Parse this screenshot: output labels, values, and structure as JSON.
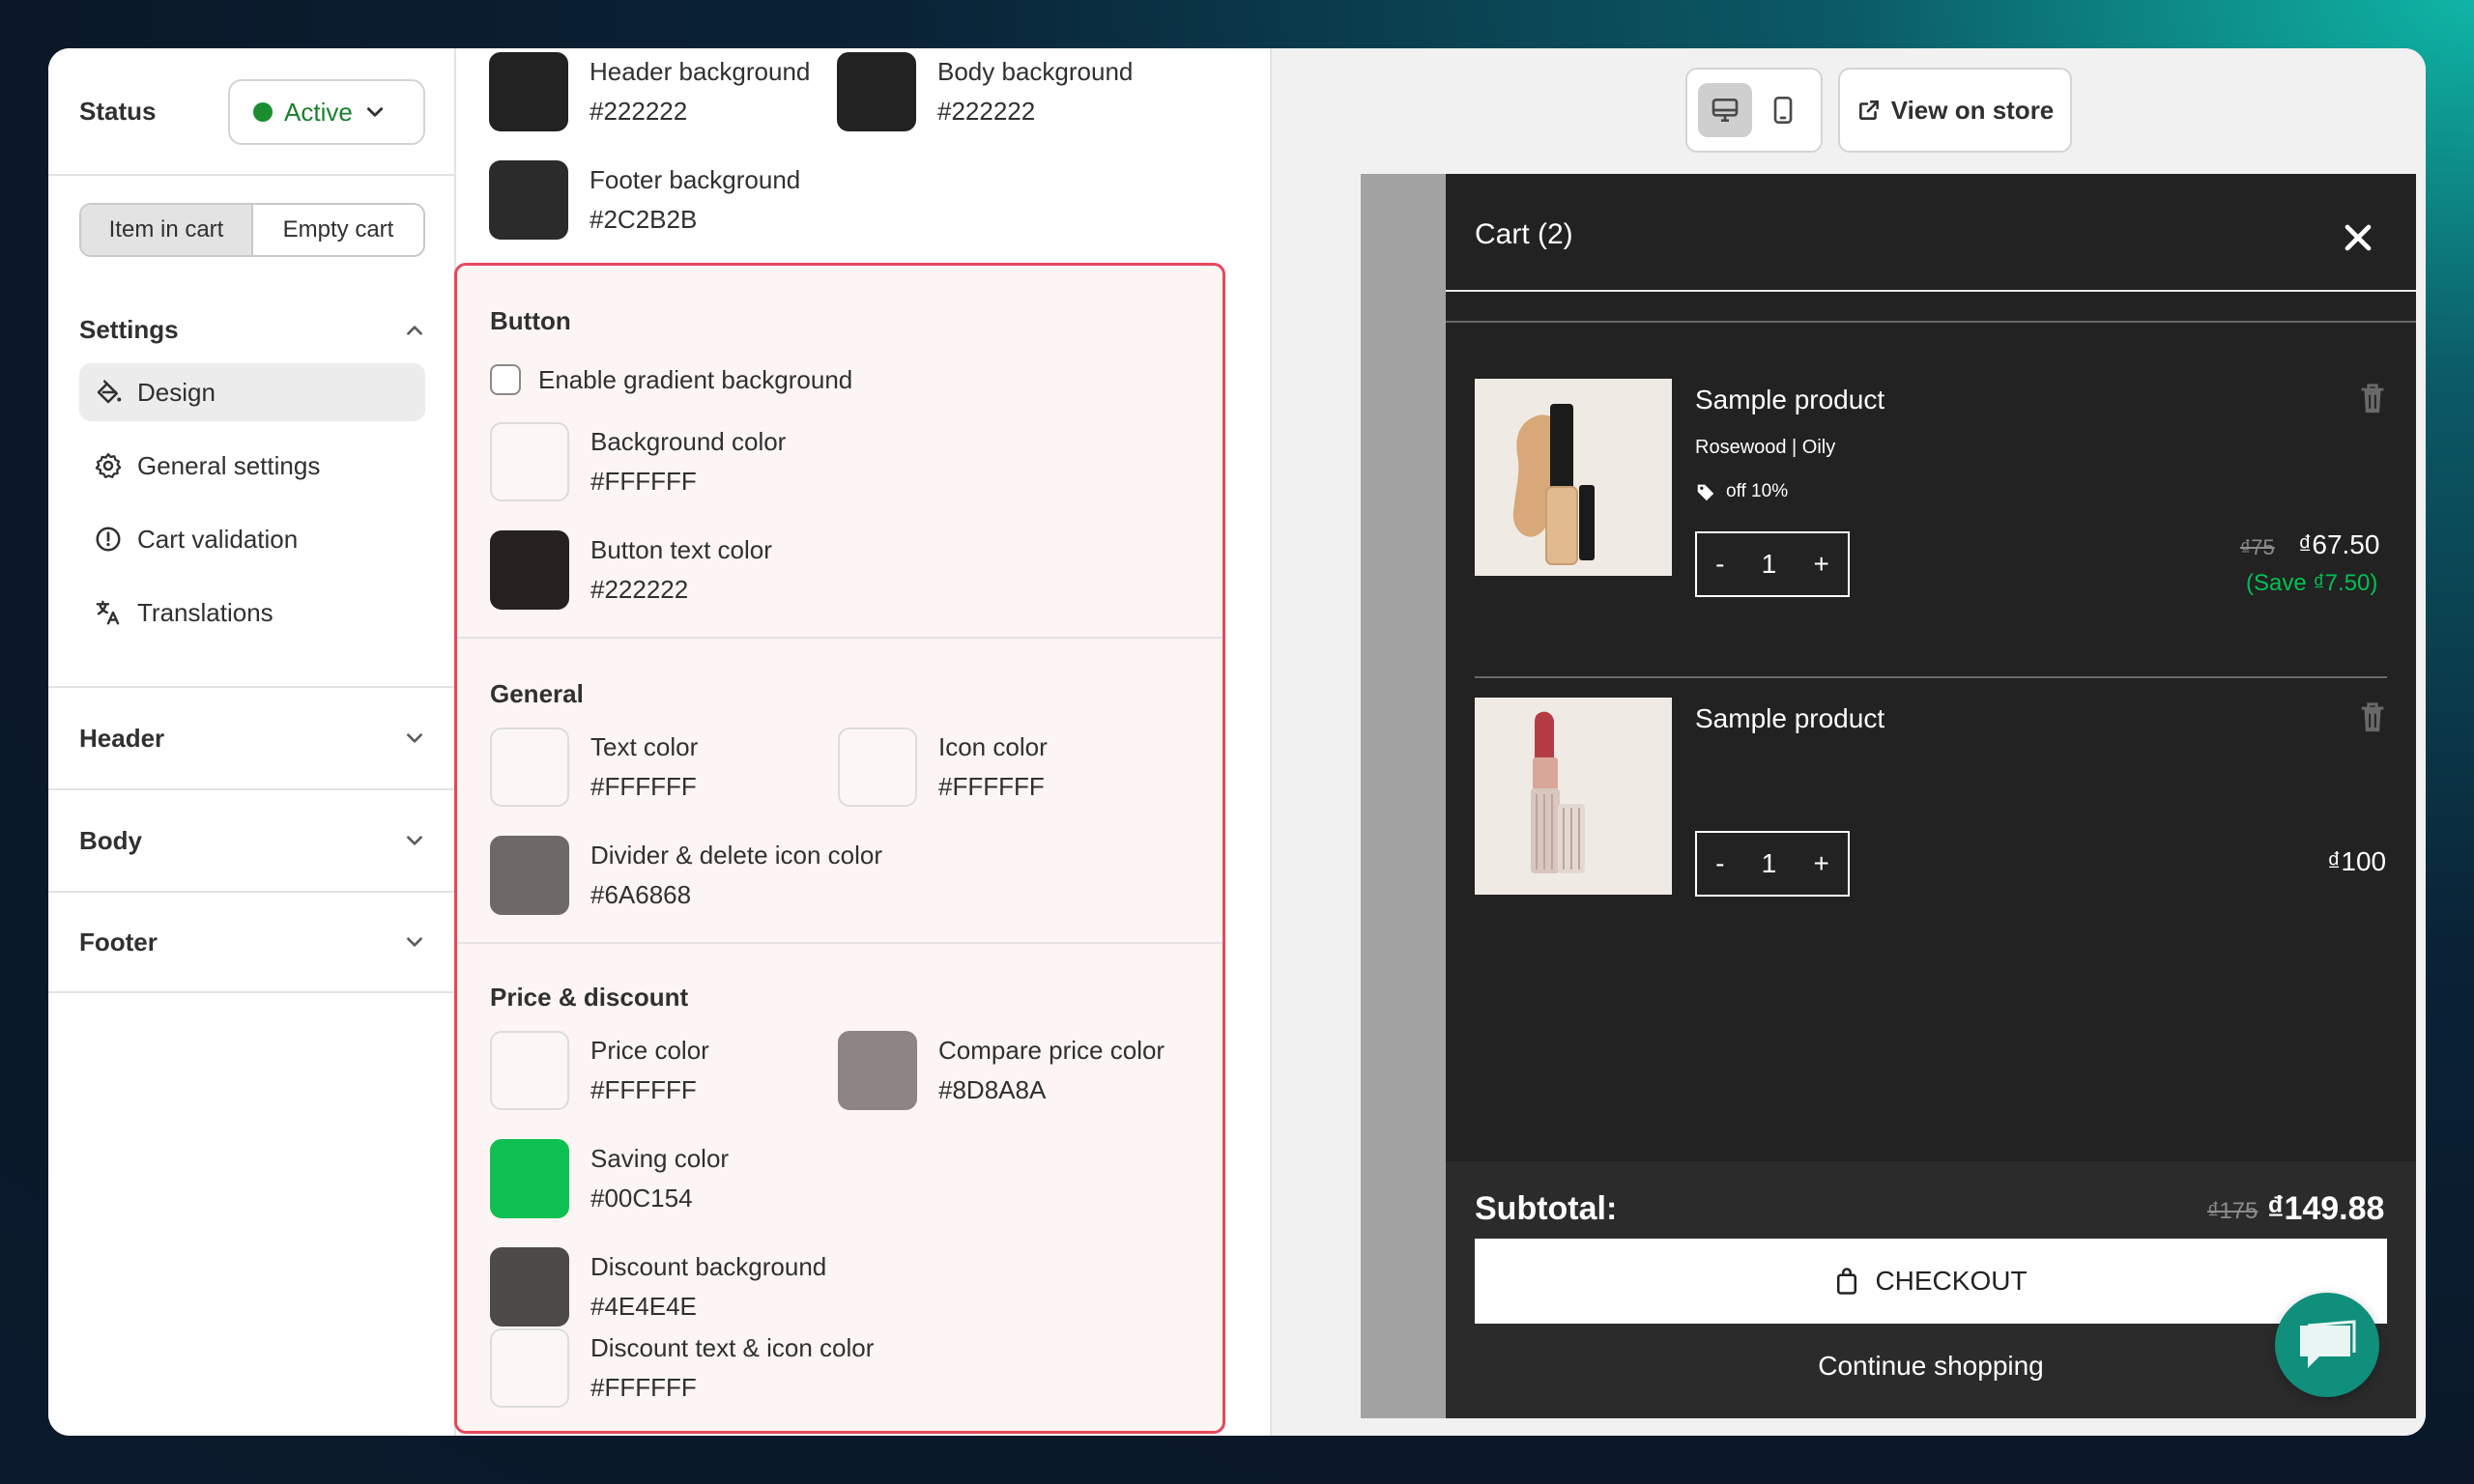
{
  "sidebar": {
    "status_label": "Status",
    "status_value": "Active",
    "status_color": "#1a8e2f",
    "segments": [
      "Item in cart",
      "Empty cart"
    ],
    "settings_title": "Settings",
    "nav": [
      {
        "label": "Design",
        "icon": "paint-bucket-icon",
        "active": true
      },
      {
        "label": "General settings",
        "icon": "gear-icon"
      },
      {
        "label": "Cart validation",
        "icon": "alert-circle-icon"
      },
      {
        "label": "Translations",
        "icon": "translate-icon"
      }
    ],
    "accordions": [
      "Header",
      "Body",
      "Footer"
    ]
  },
  "panel": {
    "top_swatches": [
      {
        "label": "Header background",
        "hex": "#222222"
      },
      {
        "label": "Body background",
        "hex": "#222222"
      },
      {
        "label": "Footer background",
        "hex": "#2C2B2B"
      }
    ],
    "button": {
      "title": "Button",
      "gradient_label": "Enable gradient background",
      "swatches": [
        {
          "label": "Background color",
          "hex": "#FFFFFF",
          "fill": "#fcf7f6"
        },
        {
          "label": "Button text color",
          "hex": "#222222",
          "fill": "#262020"
        }
      ]
    },
    "general": {
      "title": "General",
      "swatches": [
        {
          "label": "Text color",
          "hex": "#FFFFFF",
          "fill": "#fcf7f6"
        },
        {
          "label": "Icon color",
          "hex": "#FFFFFF",
          "fill": "#fcf7f6"
        },
        {
          "label": "Divider & delete icon color",
          "hex": "#6A6868",
          "fill": "#6f6868"
        }
      ]
    },
    "price": {
      "title": "Price & discount",
      "swatches": [
        {
          "label": "Price color",
          "hex": "#FFFFFF",
          "fill": "#fcf7f6"
        },
        {
          "label": "Compare price color",
          "hex": "#8D8A8A",
          "fill": "#8d8585"
        },
        {
          "label": "Saving color",
          "hex": "#00C154",
          "fill": "#0ec052"
        },
        {
          "label": "Discount background",
          "hex": "#4E4E4E",
          "fill": "#4e4a4a"
        },
        {
          "label": "Discount text & icon color",
          "hex": "#FFFFFF",
          "fill": "#fcf7f6"
        }
      ]
    }
  },
  "preview": {
    "view_store": "View on store",
    "cart": {
      "title": "Cart (2)",
      "items": [
        {
          "name": "Sample product",
          "variant": "Rosewood | Oily",
          "discount": "off 10%",
          "qty": "1",
          "compare_price": "₫75",
          "price": "₫67.50",
          "saving": "(Save ₫7.50)"
        },
        {
          "name": "Sample product",
          "qty": "1",
          "price": "₫100"
        }
      ],
      "subtotal_label": "Subtotal:",
      "subtotal_compare": "₫175",
      "subtotal": "₫149.88",
      "checkout": "CHECKOUT",
      "continue": "Continue shopping"
    }
  }
}
